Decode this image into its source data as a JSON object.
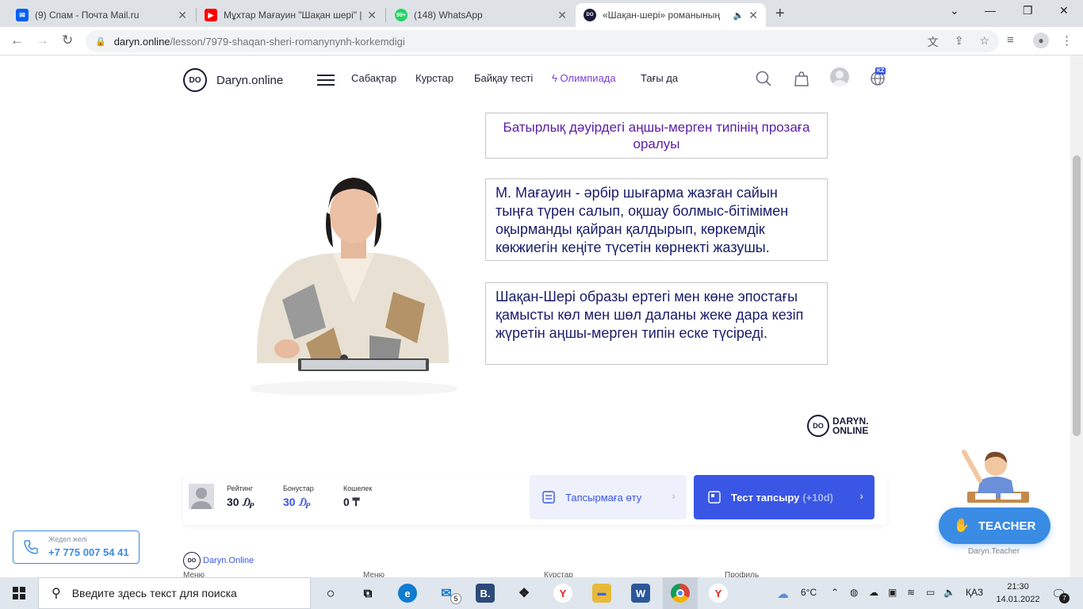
{
  "browser": {
    "tabs": [
      {
        "title": "(9) Спам - Почта Mail.ru",
        "favicon": "mail-icon",
        "color": "#005ff9"
      },
      {
        "title": "Мұхтар Мағауин \"Шақан шері\" |",
        "favicon": "youtube-icon",
        "color": "#ff0000"
      },
      {
        "title": "(148) WhatsApp",
        "favicon": "whatsapp-icon",
        "color": "#25d366",
        "badge": "99+"
      },
      {
        "title": "«Шақан-шері» романының",
        "favicon": "daryn-icon",
        "color": "#1a1b3a",
        "active": true
      }
    ],
    "url_host": "daryn.online",
    "url_path": "/lesson/7979-shaqan-sheri-romanynynh-korkemdigi"
  },
  "site": {
    "logo_mark": "DO",
    "logo_name": "Daryn.online",
    "nav": [
      "Сабақтар",
      "Курстар",
      "Байқау тесті",
      "Олимпиада",
      "Тағы да"
    ],
    "lang_badge": "KZ"
  },
  "slide": {
    "title": "Батырлық дәуірдегі  аңшы-мерген типінің прозаға оралуы",
    "p1": "М. Мағауин - әрбір шығарма жазған сайын тыңға түрен салып, оқшау болмыс-бітімімен оқырманды қайран қалдырып, көркемдік көкжиегін кеңіте түсетін көрнекті жазушы.",
    "p2": "Шақан-Шері образы ертегі мен көне эпостағы қамысты көл мен шөл даланы жеке дара кезіп жүретін аңшы-мерген типін еске түсіреді.",
    "watermark_mark": "DO",
    "watermark_line1": "DARYN.",
    "watermark_line2": "ONLINE"
  },
  "stats": {
    "rating_label": "Рейтинг",
    "rating_value": "30 ₯",
    "bonus_label": "Бонустар",
    "bonus_value": "30 ₯",
    "wallet_label": "Кошелек",
    "wallet_value": "0 ₸",
    "task_button": "Тапсырмаға өту",
    "test_button": "Тест тапсыру",
    "test_bonus": "(+10d)"
  },
  "hotline": {
    "label": "Жедел желі",
    "number": "+7 775 007 54 41"
  },
  "teacher": {
    "button": "TEACHER",
    "caption": "Daryn.Teacher"
  },
  "footer": {
    "logo_mark": "DO",
    "logo_text": "Daryn.Online",
    "columns": [
      "Меню",
      "Меню",
      "Курстар",
      "Профиль"
    ]
  },
  "taskbar": {
    "search_placeholder": "Введите здесь текст для поиска",
    "weather": "6°C",
    "lang": "ҚАЗ",
    "time": "21:30",
    "date": "14.01.2022",
    "mail_badge": "5",
    "notif_badge": "7"
  },
  "colors": {
    "accent": "#3a56e4",
    "slide_title": "#5b1ca7",
    "slide_text": "#1a1c6b",
    "olympiad": "#7b3fd9"
  }
}
